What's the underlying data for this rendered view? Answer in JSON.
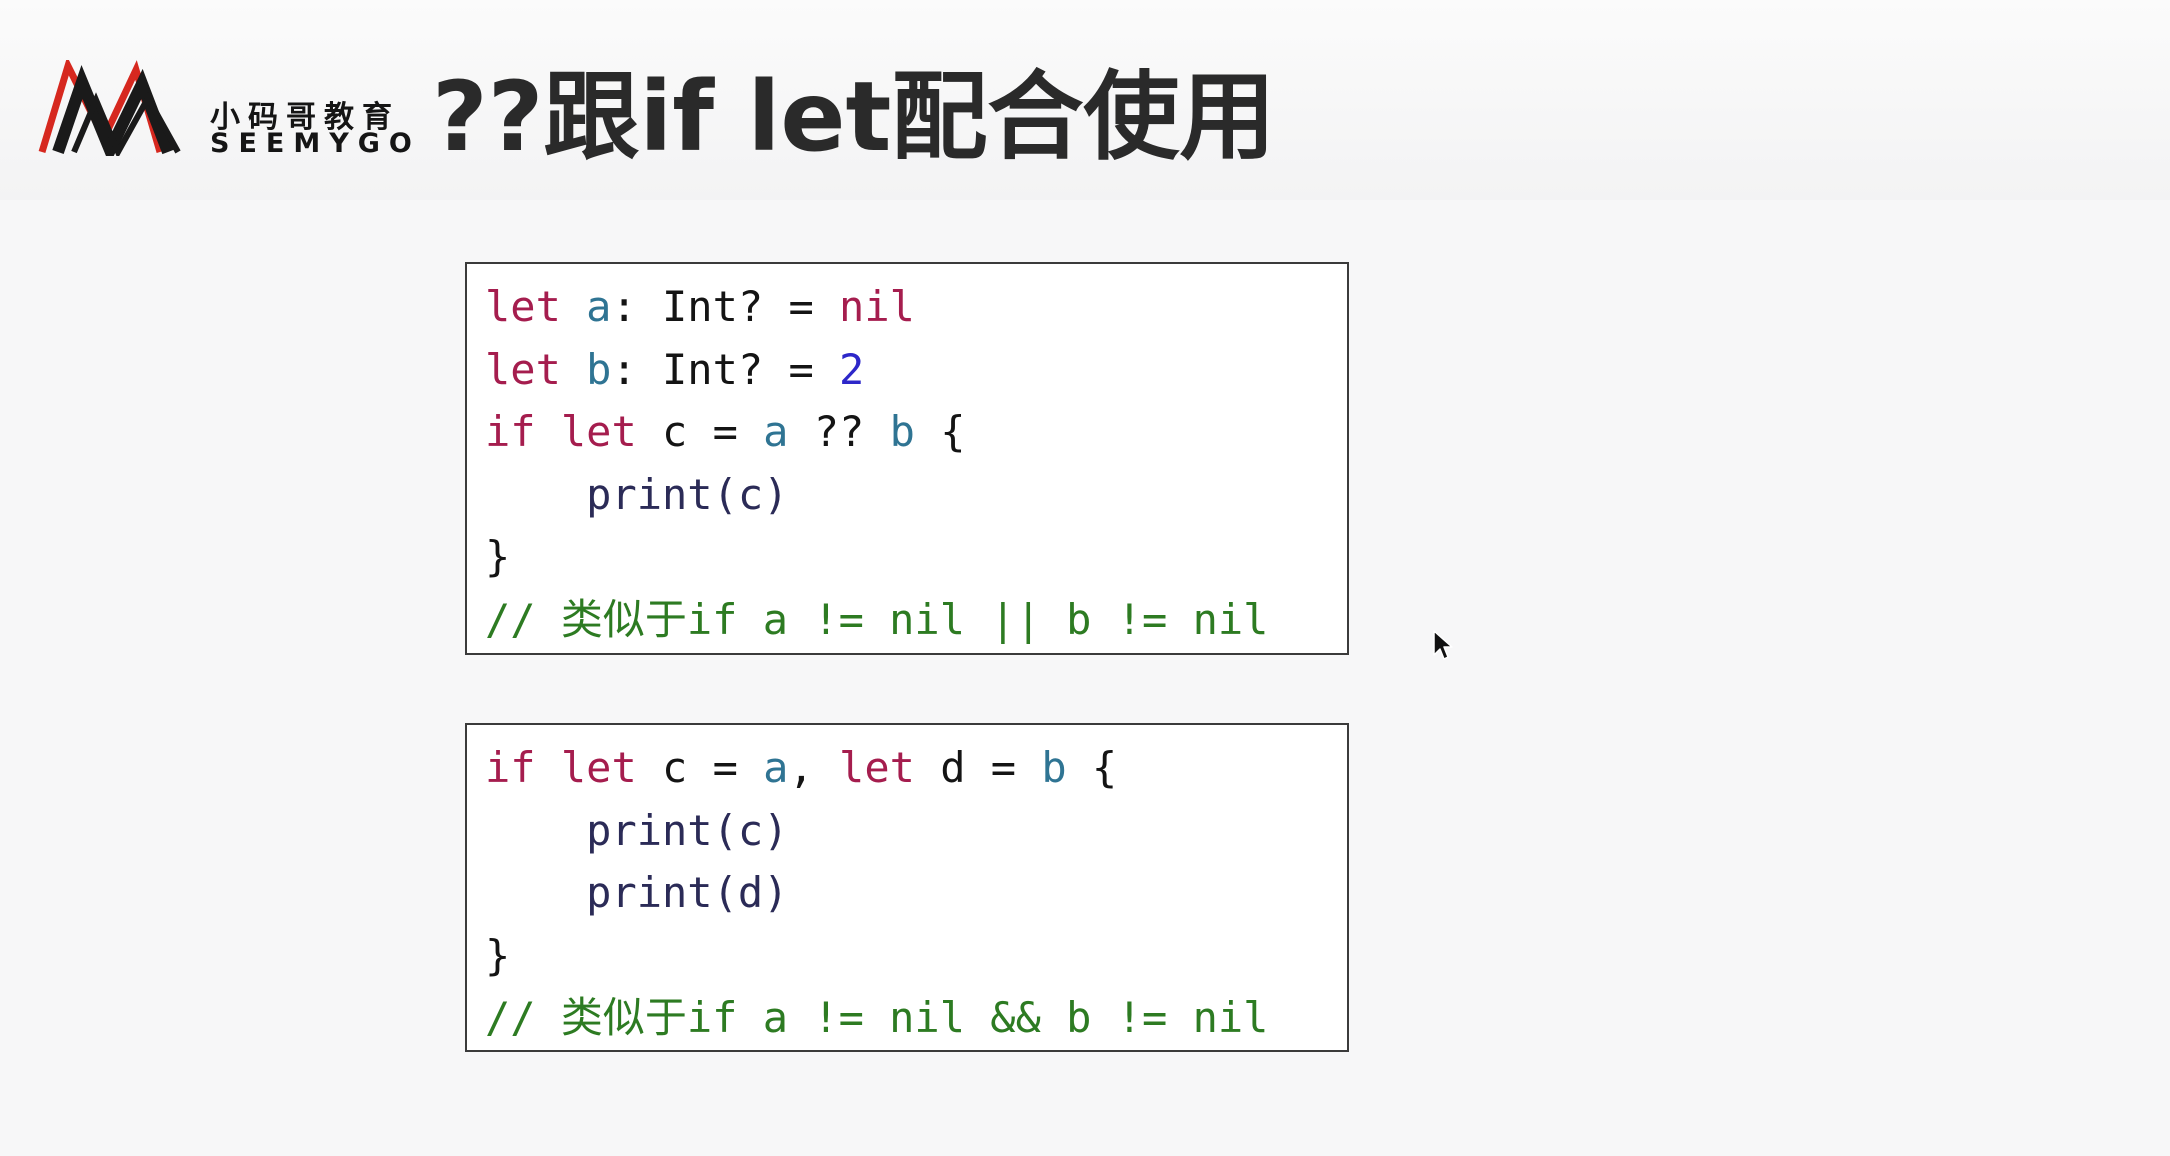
{
  "logo": {
    "cn": "小码哥教育",
    "en": "SEEMYGO",
    "colors": {
      "primary": "#1a1a1a",
      "accent": "#d6281f"
    }
  },
  "title": "??跟if let配合使用",
  "box1": {
    "l1": {
      "kw1": "let",
      "v1": "a",
      "t1": ": Int? = ",
      "kw2": "nil"
    },
    "l2": {
      "kw1": "let",
      "v1": "b",
      "t1": ": Int? = ",
      "num": "2"
    },
    "l3": {
      "kw1": "if",
      "kw2": "let",
      "t1": " c = ",
      "v1": "a",
      "t2": " ?? ",
      "v2": "b",
      "t3": " {"
    },
    "l4": {
      "indent": "    ",
      "fn": "print(c)"
    },
    "l5": {
      "t1": "}"
    },
    "comment": "// 类似于if a != nil || b != nil"
  },
  "box2": {
    "l1": {
      "kw1": "if",
      "kw2": "let",
      "t1": " c = ",
      "v1": "a",
      "t2": ", ",
      "kw3": "let",
      "t3": " d = ",
      "v2": "b",
      "t4": " {"
    },
    "l2": {
      "indent": "    ",
      "fn": "print(c)"
    },
    "l3": {
      "indent": "    ",
      "fn": "print(d)"
    },
    "l4": {
      "t1": "}"
    },
    "comment": "// 类似于if a != nil && b != nil"
  },
  "colors": {
    "keyword": "#a51d4e",
    "variable": "#2f7493",
    "number": "#2d27c9",
    "function": "#2b2b57",
    "comment": "#2d7b22"
  },
  "icons": [
    "seemygo-logo-icon",
    "mouse-cursor-icon"
  ]
}
